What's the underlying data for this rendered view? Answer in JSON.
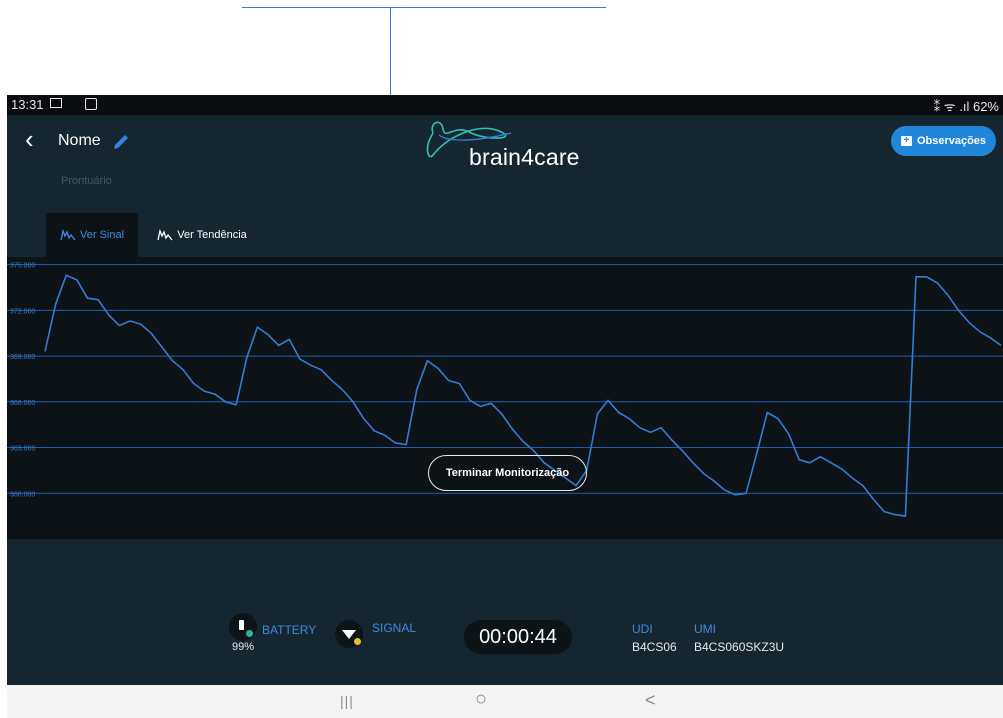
{
  "status_bar": {
    "time": "13:31",
    "indicators": "⁑ ᯤ .ıl 62%"
  },
  "header": {
    "patient_name": "Nome",
    "logo_text": "brain4care",
    "observations_button": "Observações"
  },
  "record": {
    "label": "Prontuário"
  },
  "tabs": [
    {
      "label": "Ver Sinal",
      "active": true
    },
    {
      "label": "Ver Tendência",
      "active": false
    }
  ],
  "chart_data": {
    "type": "line",
    "y_ticks": [
      "375.000",
      "372.000",
      "369.000",
      "366.000",
      "363.000",
      "360.000"
    ],
    "ylim": [
      357000,
      375500
    ],
    "grid": true,
    "series": [
      {
        "color": "#2f7fd6",
        "values": [
          369300,
          372400,
          374300,
          374000,
          372800,
          372700,
          371700,
          371000,
          371300,
          371100,
          370500,
          369600,
          368700,
          368100,
          367200,
          366700,
          366500,
          366000,
          365800,
          368900,
          370900,
          370400,
          369700,
          370100,
          368800,
          368400,
          368100,
          367400,
          366800,
          366000,
          364900,
          364100,
          363800,
          363300,
          363200,
          366800,
          368700,
          368200,
          367400,
          367200,
          366100,
          365700,
          365900,
          365200,
          364200,
          363400,
          362800,
          362000,
          361500,
          361000,
          360500,
          361500,
          365200,
          366100,
          365300,
          364900,
          364300,
          364000,
          364300,
          363500,
          362800,
          362000,
          361300,
          360800,
          360200,
          359900,
          360000,
          362600,
          365300,
          364900,
          363900,
          362200,
          362000,
          362400,
          362000,
          361600,
          361000,
          360500,
          359600,
          358800,
          358600,
          358500,
          374200,
          374200,
          373800,
          373000,
          372000,
          371200,
          370600,
          370200,
          369700
        ]
      }
    ]
  },
  "controls": {
    "terminate_button": "Terminar Monitorização"
  },
  "device": {
    "battery_label": "BATTERY",
    "battery_value": "99%",
    "signal_label": "SIGNAL",
    "timer": "00:00:44",
    "udi_label": "UDI",
    "udi_value": "B4CS06",
    "umi_label": "UMI",
    "umi_value": "B4CS060SKZ3U"
  },
  "nav_bar": {
    "recent": "|||",
    "home": "○",
    "back": "<"
  },
  "colors": {
    "accent": "#2f7fd6",
    "background": "#152630",
    "chart_bg": "#0d1216",
    "button": "#1f86d9",
    "signal_dot": "#e6c229",
    "battery_dot": "#22b8a0"
  }
}
